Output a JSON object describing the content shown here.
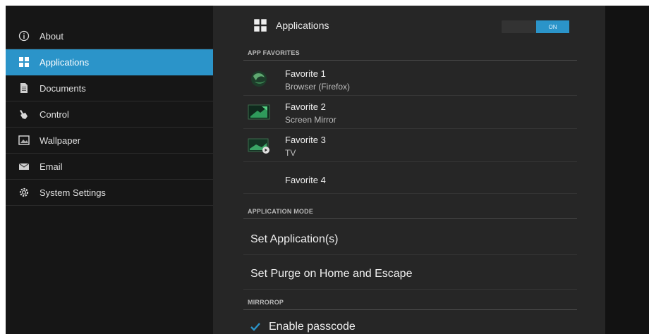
{
  "sidebar": {
    "items": [
      {
        "label": "About",
        "icon": "info-icon",
        "active": false
      },
      {
        "label": "Applications",
        "icon": "grid-icon",
        "active": true
      },
      {
        "label": "Documents",
        "icon": "document-icon",
        "active": false
      },
      {
        "label": "Control",
        "icon": "hand-pointer-icon",
        "active": false
      },
      {
        "label": "Wallpaper",
        "icon": "image-icon",
        "active": false
      },
      {
        "label": "Email",
        "icon": "envelope-icon",
        "active": false
      },
      {
        "label": "System Settings",
        "icon": "gear-icon",
        "active": false
      }
    ]
  },
  "main": {
    "header": {
      "title": "Applications",
      "toggle_label": "ON",
      "toggle_on": true
    },
    "sections": {
      "favorites": "APP FAVORITES",
      "mode": "APPLICATION MODE",
      "mirrorop": "MIRROROP"
    },
    "favorites": [
      {
        "title": "Favorite 1",
        "subtitle": "Browser (Firefox)"
      },
      {
        "title": "Favorite 2",
        "subtitle": "Screen Mirror"
      },
      {
        "title": "Favorite 3",
        "subtitle": "TV"
      },
      {
        "title": "Favorite 4",
        "subtitle": ""
      }
    ],
    "mode_items": [
      "Set Application(s)",
      "Set Purge on Home and Escape"
    ],
    "mirrorop": {
      "label": "Enable passcode",
      "checked": true
    }
  },
  "colors": {
    "accent": "#2b94c9",
    "panel": "#262626",
    "background": "#161616"
  }
}
